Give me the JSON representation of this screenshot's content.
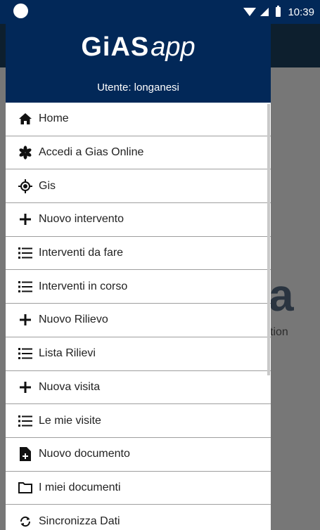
{
  "status_bar": {
    "time": "10:39"
  },
  "drawer": {
    "brand_left": "GiAS",
    "brand_right": "app",
    "user_label": "Utente: longanesi",
    "items": [
      {
        "label": "Home",
        "icon": "home-icon"
      },
      {
        "label": "Accedi a Gias Online",
        "icon": "gias-flower-icon"
      },
      {
        "label": "Gis",
        "icon": "target-icon"
      },
      {
        "label": "Nuovo intervento",
        "icon": "plus-icon"
      },
      {
        "label": "Interventi da fare",
        "icon": "list-icon"
      },
      {
        "label": "Interventi in corso",
        "icon": "list-icon"
      },
      {
        "label": "Nuovo Rilievo",
        "icon": "plus-icon"
      },
      {
        "label": "Lista Rilievi",
        "icon": "list-icon"
      },
      {
        "label": "Nuova visita",
        "icon": "plus-icon"
      },
      {
        "label": "Le mie visite",
        "icon": "list-icon"
      },
      {
        "label": "Nuovo documento",
        "icon": "new-document-icon"
      },
      {
        "label": "I miei documenti",
        "icon": "folder-icon"
      },
      {
        "label": "Sincronizza Dati",
        "icon": "sync-icon"
      }
    ]
  },
  "background": {
    "logo_letter": "a",
    "tagline": "tion"
  },
  "colors": {
    "header": "#022858",
    "scrim": "#777777",
    "text": "#222222"
  }
}
